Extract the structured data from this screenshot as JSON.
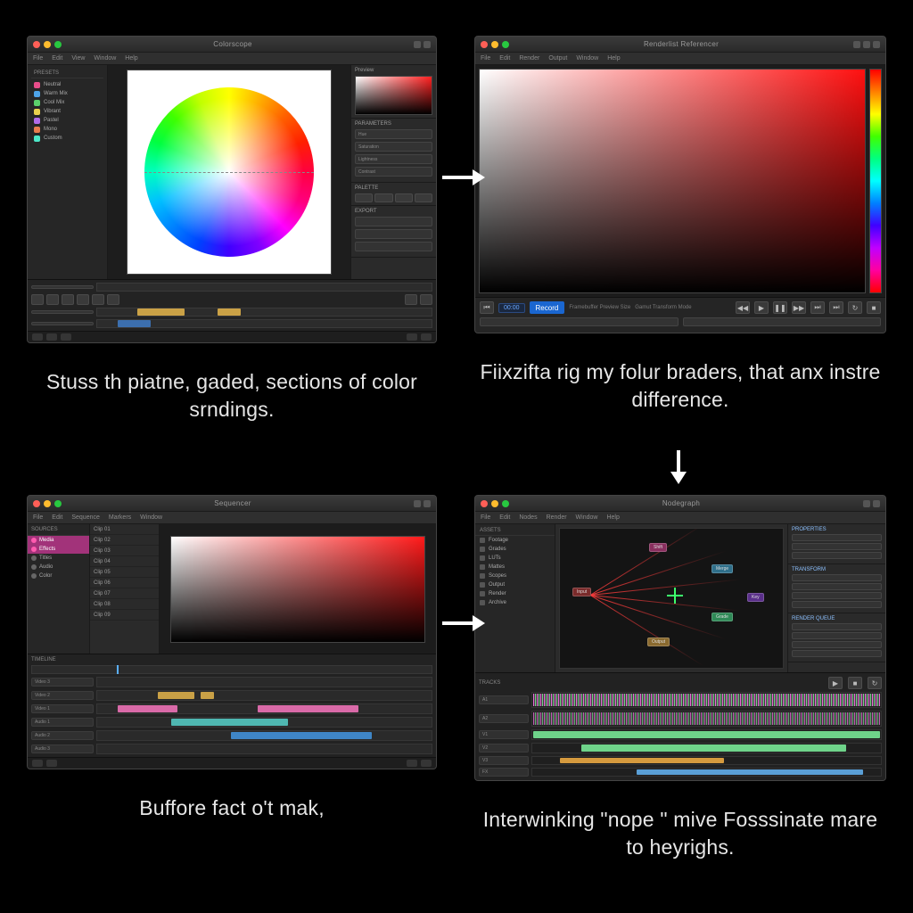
{
  "panel1": {
    "title": "Colorscope",
    "menu": [
      "File",
      "Edit",
      "View",
      "Window",
      "Help"
    ],
    "sidebar_header": "PRESETS",
    "sidebar": [
      "Neutral",
      "Warm Mix",
      "Cool Mix",
      "Vibrant",
      "Pastel",
      "Mono",
      "Custom"
    ],
    "right": {
      "sect1_title": "Preview",
      "sect2_title": "PARAMETERS",
      "params": [
        "Hue",
        "Saturation",
        "Lightness",
        "Contrast"
      ],
      "sect3_title": "PALETTE",
      "sect4_title": "EXPORT"
    },
    "caption": "Stuss th piatne, gaded, sections of color srndings."
  },
  "panel2": {
    "title": "Renderlist Referencer",
    "menu": [
      "File",
      "Edit",
      "Render",
      "Output",
      "Window",
      "Help"
    ],
    "timecode": "00:00",
    "btn_record": "Record",
    "status1": "Framebuffer Preview Size",
    "status2": "Gamut Transform Mode",
    "caption": "Fiixzifta rig my folur braders, that anx instre difference."
  },
  "panel3": {
    "title": "Sequencer",
    "menu": [
      "File",
      "Edit",
      "Sequence",
      "Markers",
      "Window"
    ],
    "left_header": "SOURCES",
    "left_items": [
      "Media",
      "Effects",
      "Titles",
      "Audio",
      "Color"
    ],
    "mid_items": [
      "Clip 01",
      "Clip 02",
      "Clip 03",
      "Clip 04",
      "Clip 05",
      "Clip 06",
      "Clip 07",
      "Clip 08",
      "Clip 09"
    ],
    "timeline_header": "TIMELINE",
    "tracks": [
      "Video 3",
      "Video 2",
      "Video 1",
      "Audio 1",
      "Audio 2",
      "Audio 3"
    ],
    "caption": "Buffore fact o't mak,"
  },
  "panel4": {
    "title": "Nodegraph",
    "menu": [
      "File",
      "Edit",
      "Nodes",
      "Render",
      "Window",
      "Help"
    ],
    "side_header": "ASSETS",
    "side_items": [
      "Footage",
      "Grades",
      "LUTs",
      "Mattes",
      "Scopes",
      "Output",
      "Render",
      "Archive"
    ],
    "nodes": [
      "Input",
      "Shift",
      "Merge",
      "Grade",
      "Output",
      "Key"
    ],
    "right_title1": "PROPERTIES",
    "right_title2": "TRANSFORM",
    "right_title3": "RENDER QUEUE",
    "timeline_header": "TRACKS",
    "wave_tracks": [
      "A1",
      "A2",
      "V1",
      "V2",
      "V3",
      "FX"
    ],
    "caption": "Interwinking \"nope \" mive Fosssinate mare to heyrighs."
  },
  "icons": {
    "play": "▶",
    "pause": "❚❚",
    "stop": "■",
    "skip_back": "⏮",
    "step_back": "◀◀",
    "step_fwd": "▶▶",
    "skip_fwd": "⏭",
    "end": "⏭",
    "loop": "↻",
    "record": "●"
  }
}
